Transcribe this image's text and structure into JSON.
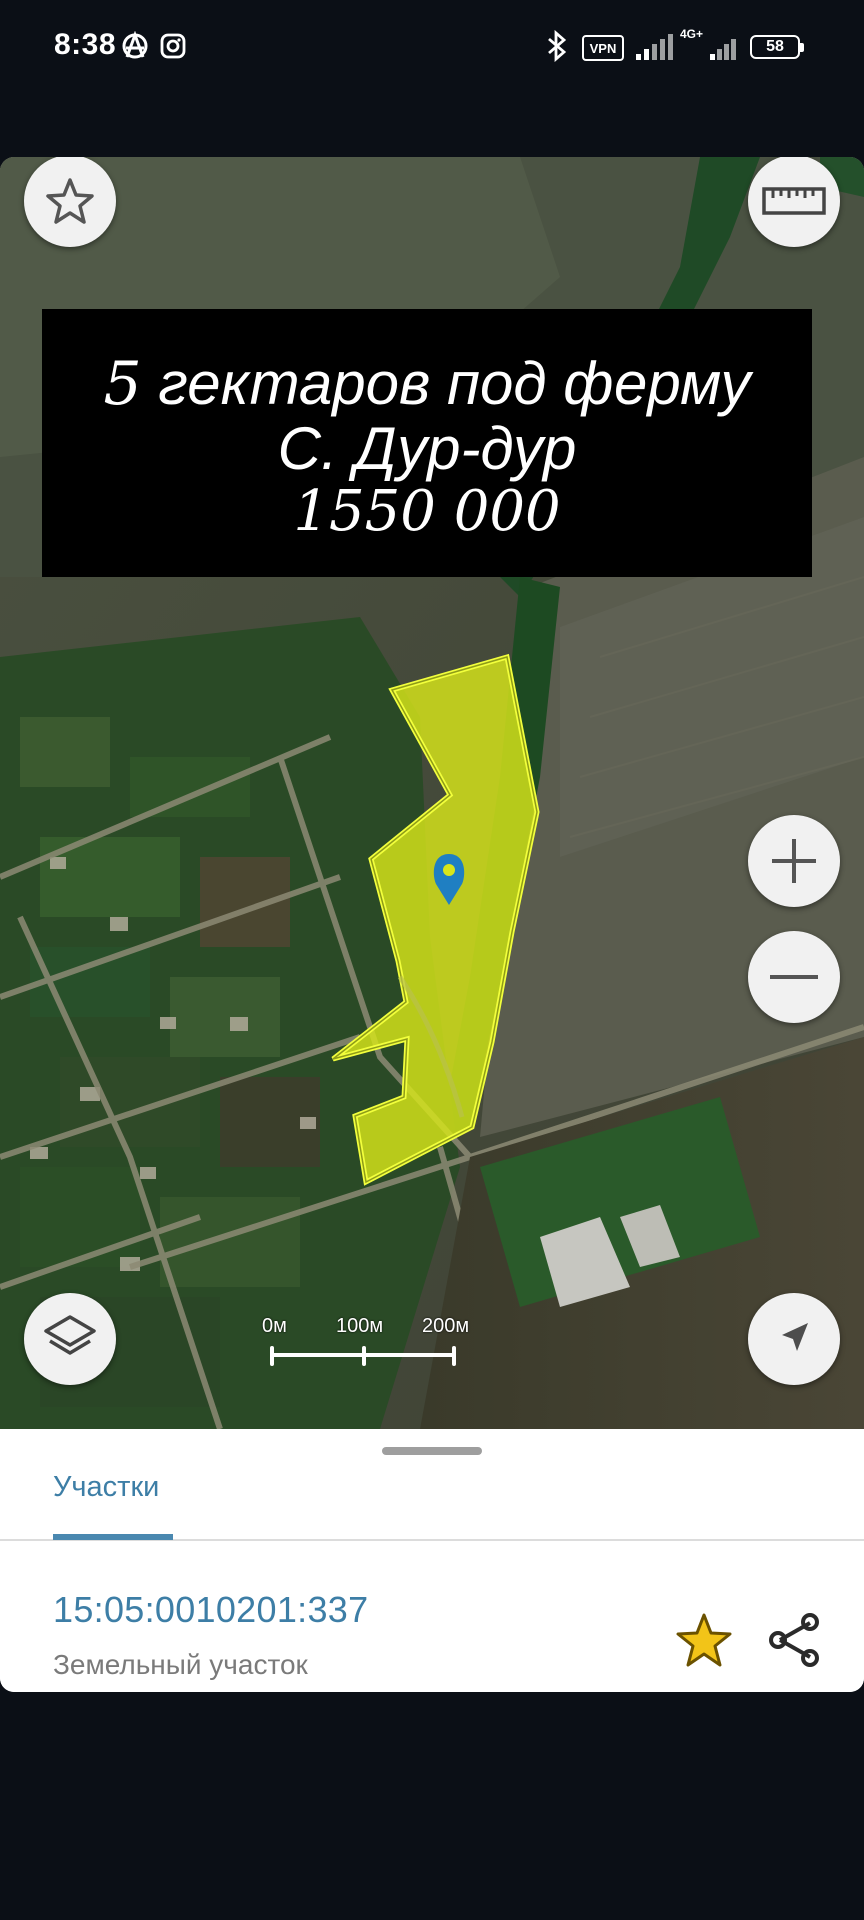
{
  "status_bar": {
    "time": "8:38",
    "vpn_label": "VPN",
    "network_label": "4G+",
    "battery_level": "58",
    "icons": [
      "anarchy-icon",
      "instagram-icon",
      "bluetooth-icon",
      "vpn-icon",
      "signal-icon",
      "signal-4g-icon",
      "battery-icon"
    ]
  },
  "map": {
    "overlay": {
      "line1_number": "5",
      "line1_text": " гектаров под ферму",
      "line2": "С. Дур-дур",
      "line3": "1550 000"
    },
    "scale": {
      "labels": [
        "0м",
        "100м",
        "200м"
      ]
    },
    "controls": [
      "favorites-star-icon",
      "ruler-icon",
      "zoom-in-icon",
      "zoom-out-icon",
      "layers-icon",
      "navigation-arrow-icon"
    ],
    "parcel_highlight_color": "#d8e61a",
    "marker_color": "#1f7fc2"
  },
  "panel": {
    "tab_label": "Участки",
    "parcel": {
      "cadastral_number": "15:05:0010201:337",
      "type": "Земельный участок"
    },
    "favorite_color": "#f2c418",
    "accent_color": "#3d7ea6"
  }
}
